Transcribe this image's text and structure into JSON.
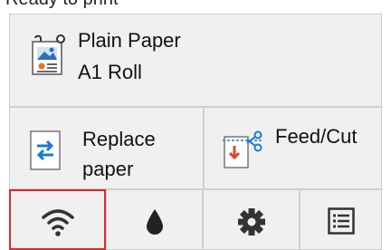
{
  "home": {
    "paper": {
      "type": "Plain Paper",
      "source": "A1 Roll"
    },
    "replace": {
      "line1": "Replace",
      "line2": "paper"
    },
    "feed_cut": {
      "label": "Feed/Cut"
    }
  },
  "nav": {
    "selected": "wifi",
    "accent_color": "#e1262d"
  }
}
